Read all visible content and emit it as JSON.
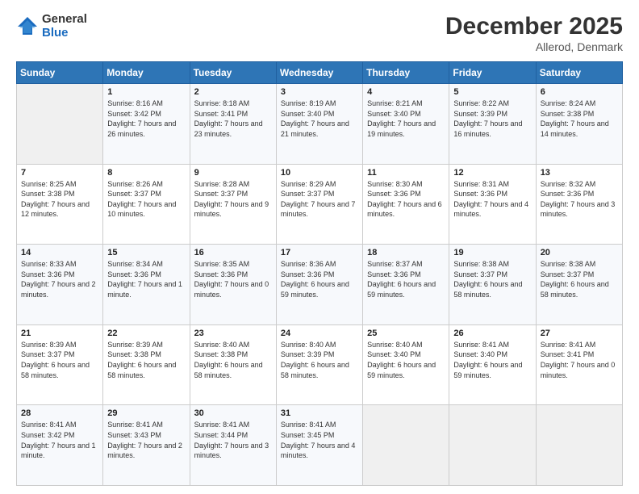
{
  "logo": {
    "general": "General",
    "blue": "Blue"
  },
  "header": {
    "title": "December 2025",
    "subtitle": "Allerod, Denmark"
  },
  "weekdays": [
    "Sunday",
    "Monday",
    "Tuesday",
    "Wednesday",
    "Thursday",
    "Friday",
    "Saturday"
  ],
  "weeks": [
    [
      {
        "num": "",
        "sunrise": "",
        "sunset": "",
        "daylight": "",
        "empty": true
      },
      {
        "num": "1",
        "sunrise": "Sunrise: 8:16 AM",
        "sunset": "Sunset: 3:42 PM",
        "daylight": "Daylight: 7 hours and 26 minutes."
      },
      {
        "num": "2",
        "sunrise": "Sunrise: 8:18 AM",
        "sunset": "Sunset: 3:41 PM",
        "daylight": "Daylight: 7 hours and 23 minutes."
      },
      {
        "num": "3",
        "sunrise": "Sunrise: 8:19 AM",
        "sunset": "Sunset: 3:40 PM",
        "daylight": "Daylight: 7 hours and 21 minutes."
      },
      {
        "num": "4",
        "sunrise": "Sunrise: 8:21 AM",
        "sunset": "Sunset: 3:40 PM",
        "daylight": "Daylight: 7 hours and 19 minutes."
      },
      {
        "num": "5",
        "sunrise": "Sunrise: 8:22 AM",
        "sunset": "Sunset: 3:39 PM",
        "daylight": "Daylight: 7 hours and 16 minutes."
      },
      {
        "num": "6",
        "sunrise": "Sunrise: 8:24 AM",
        "sunset": "Sunset: 3:38 PM",
        "daylight": "Daylight: 7 hours and 14 minutes."
      }
    ],
    [
      {
        "num": "7",
        "sunrise": "Sunrise: 8:25 AM",
        "sunset": "Sunset: 3:38 PM",
        "daylight": "Daylight: 7 hours and 12 minutes."
      },
      {
        "num": "8",
        "sunrise": "Sunrise: 8:26 AM",
        "sunset": "Sunset: 3:37 PM",
        "daylight": "Daylight: 7 hours and 10 minutes."
      },
      {
        "num": "9",
        "sunrise": "Sunrise: 8:28 AM",
        "sunset": "Sunset: 3:37 PM",
        "daylight": "Daylight: 7 hours and 9 minutes."
      },
      {
        "num": "10",
        "sunrise": "Sunrise: 8:29 AM",
        "sunset": "Sunset: 3:37 PM",
        "daylight": "Daylight: 7 hours and 7 minutes."
      },
      {
        "num": "11",
        "sunrise": "Sunrise: 8:30 AM",
        "sunset": "Sunset: 3:36 PM",
        "daylight": "Daylight: 7 hours and 6 minutes."
      },
      {
        "num": "12",
        "sunrise": "Sunrise: 8:31 AM",
        "sunset": "Sunset: 3:36 PM",
        "daylight": "Daylight: 7 hours and 4 minutes."
      },
      {
        "num": "13",
        "sunrise": "Sunrise: 8:32 AM",
        "sunset": "Sunset: 3:36 PM",
        "daylight": "Daylight: 7 hours and 3 minutes."
      }
    ],
    [
      {
        "num": "14",
        "sunrise": "Sunrise: 8:33 AM",
        "sunset": "Sunset: 3:36 PM",
        "daylight": "Daylight: 7 hours and 2 minutes."
      },
      {
        "num": "15",
        "sunrise": "Sunrise: 8:34 AM",
        "sunset": "Sunset: 3:36 PM",
        "daylight": "Daylight: 7 hours and 1 minute."
      },
      {
        "num": "16",
        "sunrise": "Sunrise: 8:35 AM",
        "sunset": "Sunset: 3:36 PM",
        "daylight": "Daylight: 7 hours and 0 minutes."
      },
      {
        "num": "17",
        "sunrise": "Sunrise: 8:36 AM",
        "sunset": "Sunset: 3:36 PM",
        "daylight": "Daylight: 6 hours and 59 minutes."
      },
      {
        "num": "18",
        "sunrise": "Sunrise: 8:37 AM",
        "sunset": "Sunset: 3:36 PM",
        "daylight": "Daylight: 6 hours and 59 minutes."
      },
      {
        "num": "19",
        "sunrise": "Sunrise: 8:38 AM",
        "sunset": "Sunset: 3:37 PM",
        "daylight": "Daylight: 6 hours and 58 minutes."
      },
      {
        "num": "20",
        "sunrise": "Sunrise: 8:38 AM",
        "sunset": "Sunset: 3:37 PM",
        "daylight": "Daylight: 6 hours and 58 minutes."
      }
    ],
    [
      {
        "num": "21",
        "sunrise": "Sunrise: 8:39 AM",
        "sunset": "Sunset: 3:37 PM",
        "daylight": "Daylight: 6 hours and 58 minutes."
      },
      {
        "num": "22",
        "sunrise": "Sunrise: 8:39 AM",
        "sunset": "Sunset: 3:38 PM",
        "daylight": "Daylight: 6 hours and 58 minutes."
      },
      {
        "num": "23",
        "sunrise": "Sunrise: 8:40 AM",
        "sunset": "Sunset: 3:38 PM",
        "daylight": "Daylight: 6 hours and 58 minutes."
      },
      {
        "num": "24",
        "sunrise": "Sunrise: 8:40 AM",
        "sunset": "Sunset: 3:39 PM",
        "daylight": "Daylight: 6 hours and 58 minutes."
      },
      {
        "num": "25",
        "sunrise": "Sunrise: 8:40 AM",
        "sunset": "Sunset: 3:40 PM",
        "daylight": "Daylight: 6 hours and 59 minutes."
      },
      {
        "num": "26",
        "sunrise": "Sunrise: 8:41 AM",
        "sunset": "Sunset: 3:40 PM",
        "daylight": "Daylight: 6 hours and 59 minutes."
      },
      {
        "num": "27",
        "sunrise": "Sunrise: 8:41 AM",
        "sunset": "Sunset: 3:41 PM",
        "daylight": "Daylight: 7 hours and 0 minutes."
      }
    ],
    [
      {
        "num": "28",
        "sunrise": "Sunrise: 8:41 AM",
        "sunset": "Sunset: 3:42 PM",
        "daylight": "Daylight: 7 hours and 1 minute."
      },
      {
        "num": "29",
        "sunrise": "Sunrise: 8:41 AM",
        "sunset": "Sunset: 3:43 PM",
        "daylight": "Daylight: 7 hours and 2 minutes."
      },
      {
        "num": "30",
        "sunrise": "Sunrise: 8:41 AM",
        "sunset": "Sunset: 3:44 PM",
        "daylight": "Daylight: 7 hours and 3 minutes."
      },
      {
        "num": "31",
        "sunrise": "Sunrise: 8:41 AM",
        "sunset": "Sunset: 3:45 PM",
        "daylight": "Daylight: 7 hours and 4 minutes."
      },
      {
        "num": "",
        "sunrise": "",
        "sunset": "",
        "daylight": "",
        "empty": true
      },
      {
        "num": "",
        "sunrise": "",
        "sunset": "",
        "daylight": "",
        "empty": true
      },
      {
        "num": "",
        "sunrise": "",
        "sunset": "",
        "daylight": "",
        "empty": true
      }
    ]
  ]
}
